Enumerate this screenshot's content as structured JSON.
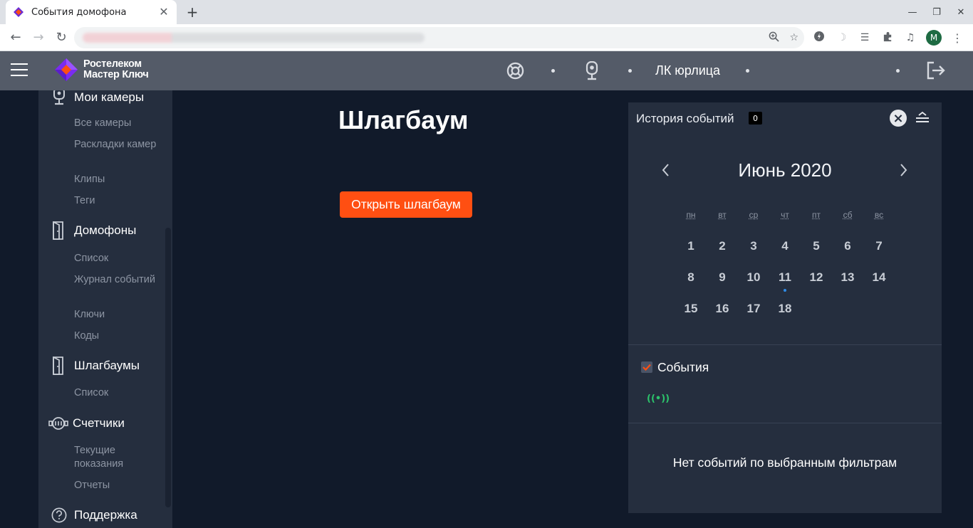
{
  "browser": {
    "tab_title": "События домофона",
    "new_tab": "+",
    "close_tab": "✕",
    "avatar_letter": "M",
    "favicon_color": "#6a2bd6"
  },
  "header": {
    "logo_line1": "Ростелеком",
    "logo_line2": "Мастер Ключ",
    "account_label": "ЛК юрлица",
    "bg_color": "#545b68"
  },
  "sidebar": {
    "sections": [
      {
        "label": "Мои камеры",
        "icon": "camera-icon",
        "items": [
          "Все камеры",
          "Раскладки камер",
          "Клипы",
          "Теги"
        ]
      },
      {
        "label": "Домофоны",
        "icon": "door-icon",
        "items": [
          "Список",
          "Журнал событий",
          "Ключи",
          "Коды"
        ]
      },
      {
        "label": "Шлагбаумы",
        "icon": "barrier-icon",
        "items": [
          "Список"
        ]
      },
      {
        "label": "Счетчики",
        "icon": "meter-icon",
        "items": [
          "Текущие показания",
          "Отчеты"
        ]
      },
      {
        "label": "Поддержка",
        "icon": "help-icon",
        "items": []
      }
    ]
  },
  "main": {
    "title": "Шлагбаум",
    "open_button": "Открыть шлагбаум",
    "accent_color": "#ff4f12"
  },
  "panel": {
    "title": "История событий",
    "badge": "0",
    "month": "Июнь 2020",
    "weekdays": [
      "пн",
      "вт",
      "ср",
      "чт",
      "пт",
      "сб",
      "вс"
    ],
    "days": [
      "1",
      "2",
      "3",
      "4",
      "5",
      "6",
      "7",
      "8",
      "9",
      "10",
      "11",
      "12",
      "13",
      "14",
      "15",
      "16",
      "17",
      "18"
    ],
    "marked_day": "11",
    "filter_label": "События",
    "event_icon_text": "((•))",
    "empty_text": "Нет событий по выбранным фильтрам"
  }
}
